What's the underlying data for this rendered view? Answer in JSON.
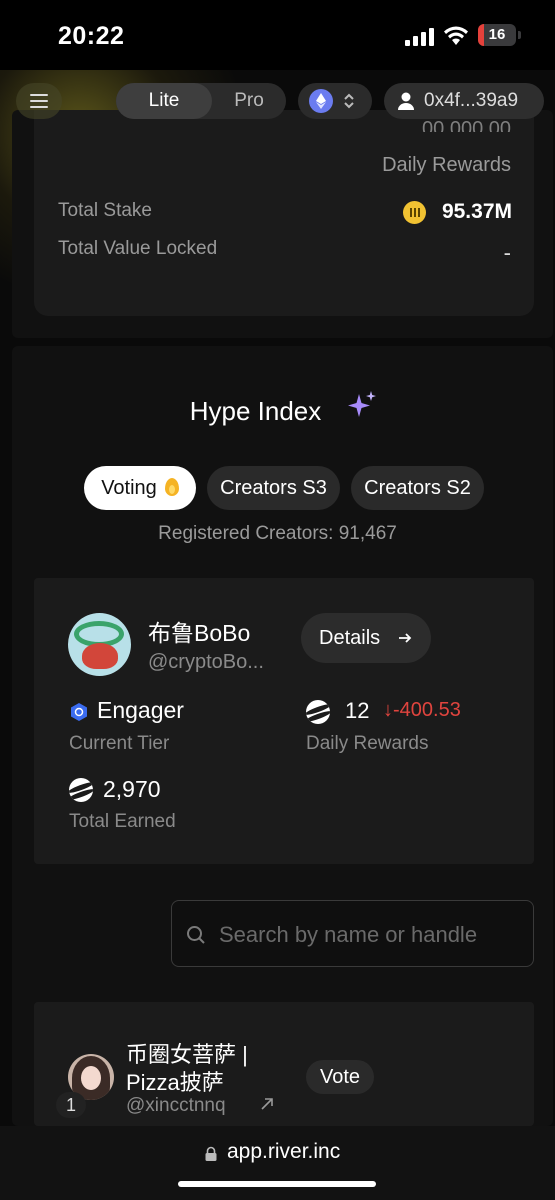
{
  "status_bar": {
    "time": "20:22",
    "battery": "16",
    "battery_level": 0.16
  },
  "header": {
    "mode_options": [
      "Lite",
      "Pro"
    ],
    "selected_mode": "Lite",
    "chain_icon": "ethereum-icon",
    "wallet_address": "0x4f...39a9"
  },
  "stake_card": {
    "daily_rewards_value": "00,000.00",
    "daily_rewards_label": "Daily Rewards",
    "total_stake_label": "Total Stake",
    "total_stake_value": "95.37M",
    "tvl_label": "Total Value Locked",
    "tvl_value": "-"
  },
  "hype": {
    "title": "Hype Index",
    "tabs": [
      "Voting",
      "Creators S3",
      "Creators S2"
    ],
    "active_tab": "Voting",
    "registered": "Registered Creators: 91,467"
  },
  "creator": {
    "name": "布鲁BoBo",
    "handle": "@cryptoBo...",
    "details_label": "Details",
    "tier_value": "Engager",
    "tier_label": "Current Tier",
    "daily_rewards_value": "12",
    "daily_rewards_delta": "-400.53",
    "daily_rewards_label": "Daily Rewards",
    "total_earned_value": "2,970",
    "total_earned_label": "Total Earned"
  },
  "search": {
    "placeholder": "Search by name or handle"
  },
  "leaderboard": [
    {
      "rank": "1",
      "name_line1": "币圈女菩萨 |",
      "name_line2": "Pizza披萨",
      "handle": "@xincctnnq",
      "vote_label": "Vote"
    }
  ],
  "browser": {
    "url": "app.river.inc"
  },
  "colors": {
    "accent_gold": "#f1c232",
    "negative": "#e0443e",
    "background": "#0a0a0a",
    "card": "#1b1b1b"
  }
}
